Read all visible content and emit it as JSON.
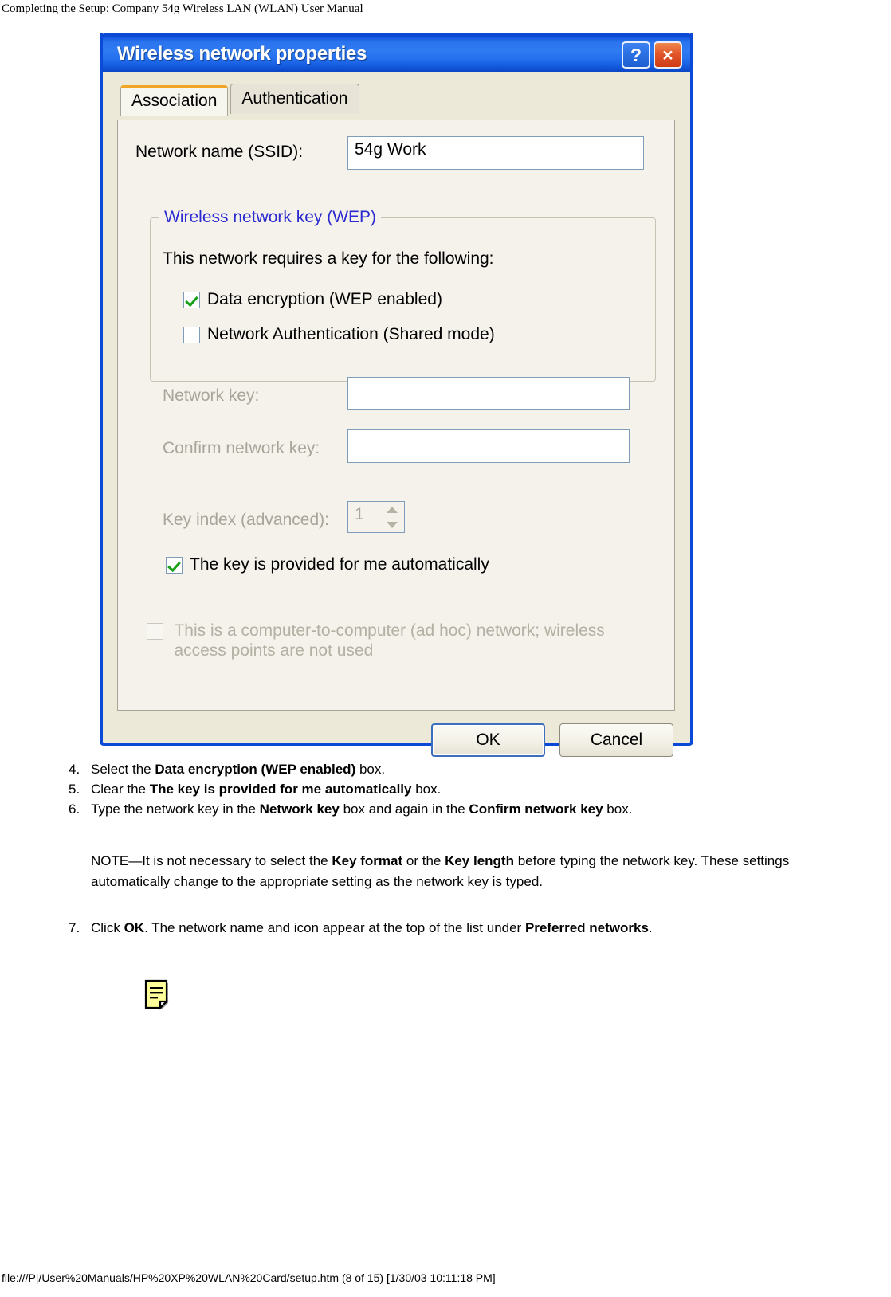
{
  "page": {
    "header_title": "Completing the Setup: Company 54g Wireless LAN (WLAN) User Manual",
    "footer_path": "file:///P|/User%20Manuals/HP%20XP%20WLAN%20Card/setup.htm (8 of 15) [1/30/03 10:11:18 PM]"
  },
  "colors": {
    "titlebar_blue": "#1f66e4",
    "dialog_border": "#0a4ad6",
    "dialog_face": "#ece9d8",
    "tab_active_accent": "#f0a525",
    "group_title_blue": "#2a2ad0",
    "check_green": "#18a018",
    "close_button": "#e2562a",
    "disabled_text": "#a8a69a"
  },
  "dialog": {
    "title": "Wireless network properties",
    "titlebar_buttons": [
      {
        "name": "help-button",
        "glyph": "?"
      },
      {
        "name": "close-button",
        "glyph": "×"
      }
    ],
    "tabs": [
      {
        "label": "Association",
        "active": true
      },
      {
        "label": "Authentication",
        "active": false
      }
    ],
    "ssid": {
      "label": "Network name (SSID):",
      "value": "54g Work",
      "placeholder": ""
    },
    "wep_group": {
      "legend": "Wireless network key (WEP)",
      "intro": "This network requires a key for the following:",
      "checkboxes": [
        {
          "label": "Data encryption (WEP enabled)",
          "checked": true,
          "disabled": false
        },
        {
          "label": "Network Authentication (Shared mode)",
          "checked": false,
          "disabled": false
        }
      ],
      "network_key": {
        "label": "Network key:",
        "value": "",
        "disabled": true
      },
      "confirm_network_key": {
        "label": "Confirm network key:",
        "value": "",
        "disabled": true
      },
      "key_index": {
        "label": "Key index (advanced):",
        "value": "1",
        "disabled": true
      },
      "auto_key": {
        "label": "The key is provided for me automatically",
        "checked": true,
        "disabled": false
      }
    },
    "adhoc": {
      "label_line1": "This is a computer-to-computer (ad hoc) network; wireless",
      "label_line2": "access points are not used",
      "checked": false,
      "disabled": true
    },
    "buttons": [
      {
        "label": "OK",
        "default": true
      },
      {
        "label": "Cancel",
        "default": false
      }
    ]
  },
  "instructions": {
    "steps": [
      {
        "number": "4.",
        "parts": [
          {
            "text": "Select the ",
            "bold": false
          },
          {
            "text": "Data encryption (WEP enabled)",
            "bold": true
          },
          {
            "text": " box.",
            "bold": false
          }
        ]
      },
      {
        "number": "5.",
        "parts": [
          {
            "text": "Clear the ",
            "bold": false
          },
          {
            "text": "The key is provided for me automatically",
            "bold": true
          },
          {
            "text": " box.",
            "bold": false
          }
        ]
      },
      {
        "number": "6.",
        "parts": [
          {
            "text": "Type the network key in the ",
            "bold": false
          },
          {
            "text": "Network key",
            "bold": true
          },
          {
            "text": " box and again in the ",
            "bold": false
          },
          {
            "text": "Confirm network key",
            "bold": true
          },
          {
            "text": " box.",
            "bold": false
          }
        ]
      }
    ],
    "note": {
      "parts": [
        {
          "text": "NOTE—It is not necessary to select the ",
          "bold": false
        },
        {
          "text": "Key format",
          "bold": true
        },
        {
          "text": " or the ",
          "bold": false
        },
        {
          "text": "Key length",
          "bold": true
        },
        {
          "text": " before typing the network key. These settings automatically change to the appropriate setting as the network key is typed.",
          "bold": false
        }
      ]
    },
    "step7": {
      "number": "7.",
      "parts": [
        {
          "text": "Click ",
          "bold": false
        },
        {
          "text": "OK",
          "bold": true
        },
        {
          "text": ". The network name and icon appear at the top of the list under ",
          "bold": false
        },
        {
          "text": "Preferred networks",
          "bold": true
        },
        {
          "text": ".",
          "bold": false
        }
      ]
    },
    "note_icon": "note-document-icon"
  }
}
